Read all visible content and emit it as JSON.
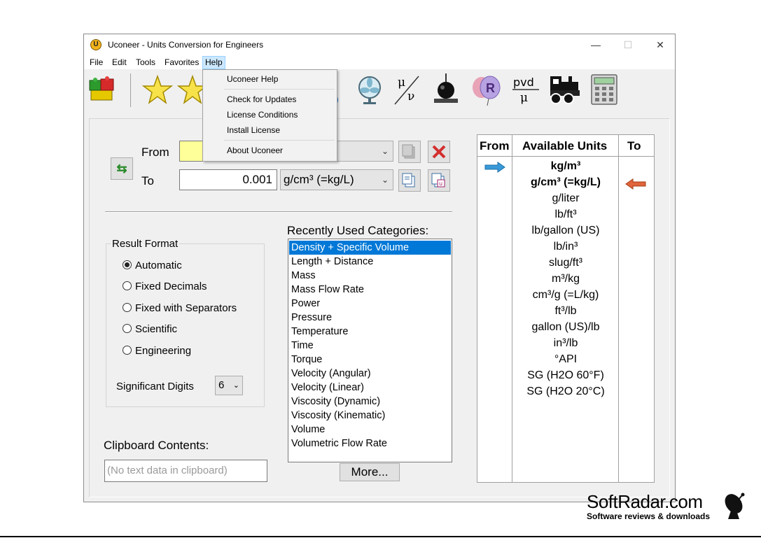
{
  "window": {
    "title": "Uconeer - Units Conversion for Engineers",
    "app_icon": "U",
    "controls": {
      "minimize": "—",
      "maximize": "☐",
      "close": "✕"
    }
  },
  "menubar": [
    "File",
    "Edit",
    "Tools",
    "Favorites",
    "Help"
  ],
  "help_menu": {
    "items": [
      "Uconeer Help",
      "Check for Updates",
      "License Conditions",
      "Install License",
      "About Uconeer"
    ]
  },
  "toolbar": {
    "icons": [
      "legos-icon",
      "star-favorite-icon",
      "star-favorite-2-icon",
      "water-drop-icon",
      "fan-icon",
      "mu-nu-icon",
      "weight-icon",
      "balloon-r-icon",
      "pvd-mu-icon",
      "locomotive-icon",
      "calculator-icon"
    ],
    "labels": {
      "mu_nu_top": "μ",
      "mu_nu_bottom": "ν",
      "pvd_top": "pvd",
      "pvd_bottom": "μ",
      "balloon": "R"
    }
  },
  "converter": {
    "from_label": "From",
    "to_label": "To",
    "to_value": "0.001",
    "to_unit": "g/cm³ (=kg/L)",
    "swap_icon": "swap-arrows-icon"
  },
  "result_format": {
    "title": "Result Format",
    "options": [
      "Automatic",
      "Fixed Decimals",
      "Fixed with Separators",
      "Scientific",
      "Engineering"
    ],
    "selected": "Automatic",
    "digits_label": "Significant Digits",
    "digits_value": "6"
  },
  "clipboard": {
    "label": "Clipboard Contents:",
    "value": "(No text data in clipboard)"
  },
  "categories": {
    "label": "Recently Used Categories:",
    "items": [
      "Density + Specific Volume",
      "Length + Distance",
      "Mass",
      "Mass Flow Rate",
      "Power",
      "Pressure",
      "Temperature",
      "Time",
      "Torque",
      "Velocity (Angular)",
      "Velocity (Linear)",
      "Viscosity (Dynamic)",
      "Viscosity (Kinematic)",
      "Volume",
      "Volumetric Flow Rate"
    ],
    "selected": "Density + Specific Volume",
    "more_button": "More..."
  },
  "units": {
    "headers": {
      "from": "From",
      "available": "Available Units",
      "to": "To"
    },
    "items": [
      "kg/m³",
      "g/cm³ (=kg/L)",
      "g/liter",
      "lb/ft³",
      "lb/gallon (US)",
      "lb/in³",
      "slug/ft³",
      "m³/kg",
      "cm³/g (=L/kg)",
      "ft³/lb",
      "gallon (US)/lb",
      "in³/lb",
      "°API",
      "SG (H2O 60°F)",
      "SG (H2O 20°C)"
    ],
    "from_unit": "kg/m³",
    "to_unit": "g/cm³ (=kg/L)"
  },
  "colors": {
    "accent": "#0078d7",
    "from_field": "#ffff99",
    "clear_red": "#d32f2f",
    "from_arrow": "#3a9ad9",
    "to_arrow": "#e0653a"
  },
  "watermark": {
    "main": "SoftRadar.com",
    "sub": "Software reviews & downloads"
  }
}
